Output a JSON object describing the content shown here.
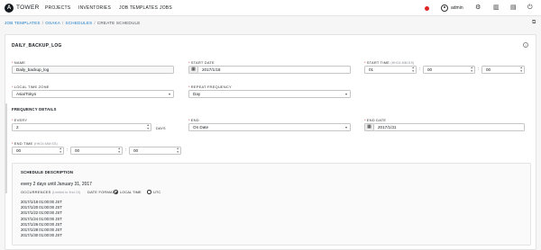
{
  "app": {
    "brand": "TOWER",
    "logo_letter": "A"
  },
  "nav": {
    "items": [
      "PROJECTS",
      "INVENTORIES",
      "JOB TEMPLATES",
      "JOBS"
    ],
    "user": "admin",
    "status_color": "#e02424"
  },
  "breadcrumb": {
    "items": [
      "JOB TEMPLATES",
      "OSAKA",
      "SCHEDULES"
    ],
    "current": "CREATE SCHEDULE"
  },
  "form": {
    "title": "DAILY_BACKUP_LOG",
    "name_label": "NAME",
    "name_value": "Daily_backup_log",
    "start_date_label": "START DATE",
    "start_date_value": "2017/1/18",
    "start_time_label": "START TIME",
    "start_time_hint": "(HH24:MM:SS)",
    "start_time": {
      "hh": "01",
      "mm": "00",
      "ss": "00"
    },
    "timezone_label": "LOCAL TIME ZONE",
    "timezone_value": "Asia/Tokyo",
    "repeat_label": "REPEAT FREQUENCY",
    "repeat_value": "Day",
    "frequency_title": "FREQUENCY DETAILS",
    "every_label": "EVERY",
    "every_value": "2",
    "every_unit": "DAYS",
    "end_label": "END",
    "end_value": "On Date",
    "end_date_label": "END DATE",
    "end_date_value": "2017/1/31",
    "end_time_label": "END TIME",
    "end_time_hint": "(HH24:MM:SS)",
    "end_time": {
      "hh": "00",
      "mm": "00",
      "ss": "00"
    }
  },
  "description": {
    "title": "SCHEDULE DESCRIPTION",
    "text": "every 2 days until January 31, 2017",
    "occurrences_label": "OCCURRENCES",
    "occurrences_hint": "(Limited to first 10)",
    "date_format_label": "DATE FORMAT",
    "format_local": "LOCAL TIME",
    "format_utc": "UTC",
    "selected_format": "local",
    "occurrences": [
      "2017/1/18 01:00:00 JST",
      "2017/1/20 01:00:00 JST",
      "2017/1/22 01:00:00 JST",
      "2017/1/24 01:00:00 JST",
      "2017/1/26 01:00:00 JST",
      "2017/1/28 01:00:00 JST",
      "2017/1/30 01:00:00 JST"
    ]
  },
  "icons": [
    "tower-logo-icon",
    "status-dot-icon",
    "user-icon",
    "gear-icon",
    "book-icon",
    "docs-icon",
    "power-icon",
    "calendar-icon",
    "help-icon",
    "external-link-icon"
  ]
}
